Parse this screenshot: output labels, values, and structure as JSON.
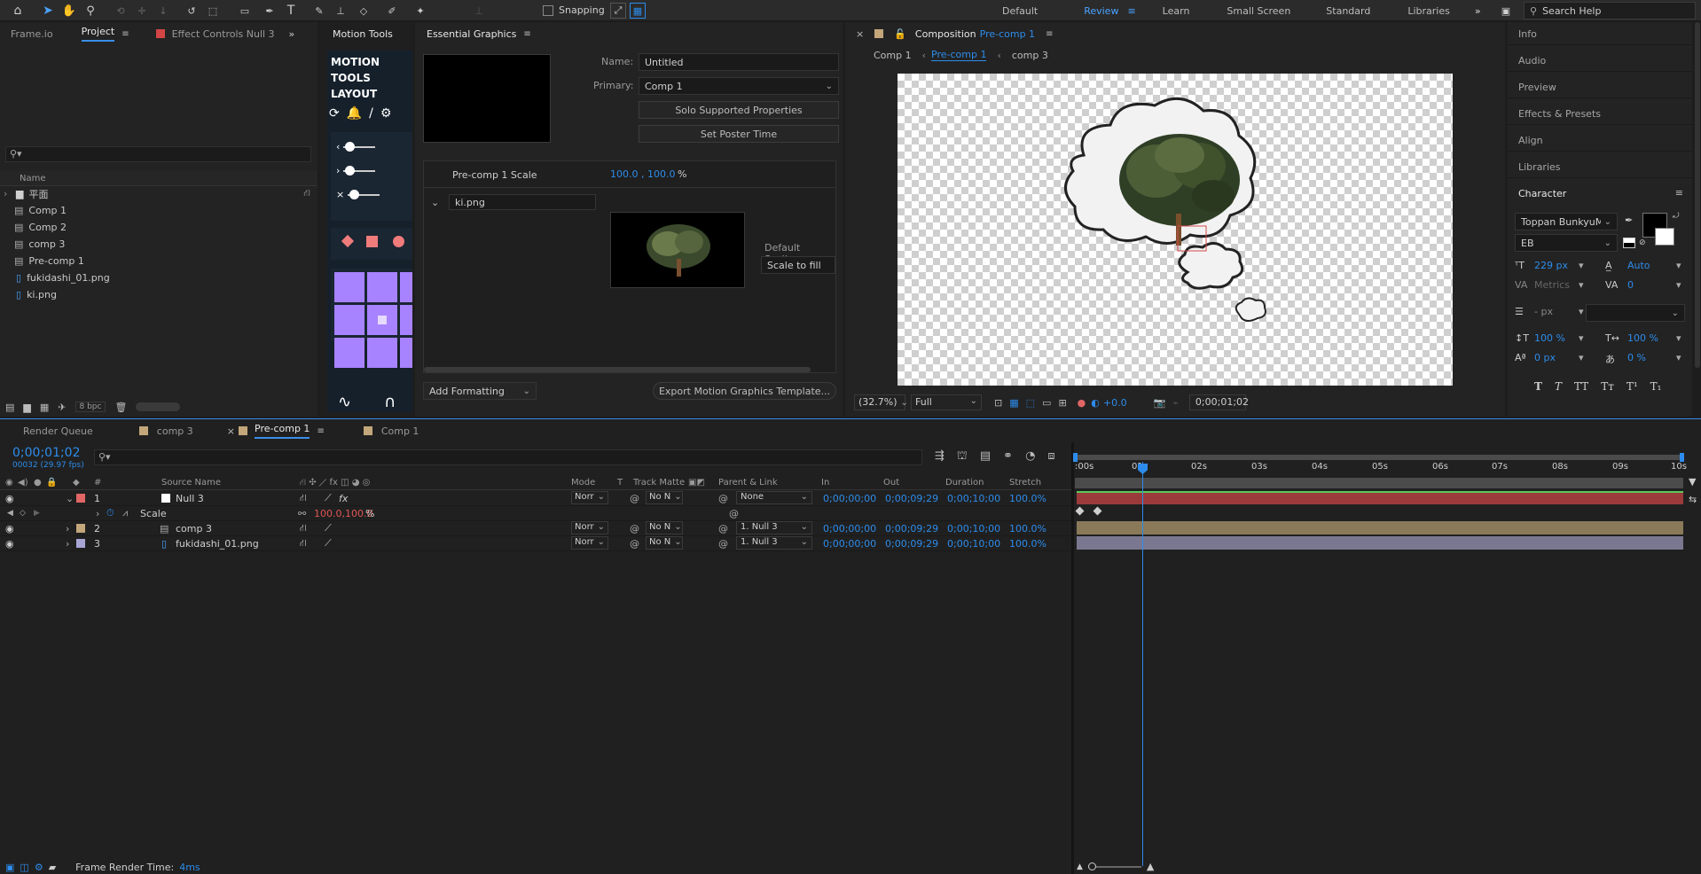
{
  "toolbar": {
    "snapping_label": "Snapping",
    "workspaces": [
      "Default",
      "Review",
      "Learn",
      "Small Screen",
      "Standard",
      "Libraries"
    ],
    "active_workspace": "Review",
    "search_placeholder": "Search Help"
  },
  "project_panel": {
    "tabs": [
      "Frame.io",
      "Project",
      "Effect Controls Null 3"
    ],
    "column_name": "Name",
    "items": [
      {
        "name": "平面",
        "type": "folder"
      },
      {
        "name": "Comp 1",
        "type": "comp"
      },
      {
        "name": "Comp 2",
        "type": "comp"
      },
      {
        "name": "comp 3",
        "type": "comp"
      },
      {
        "name": "Pre-comp 1",
        "type": "comp"
      },
      {
        "name": "fukidashi_01.png",
        "type": "file"
      },
      {
        "name": "ki.png",
        "type": "file"
      }
    ],
    "bpc": "8 bpc"
  },
  "motion_tools": {
    "tab": "Motion Tools",
    "title_lines": [
      "MOTION",
      "TOOLS",
      "LAYOUT"
    ]
  },
  "essential_graphics": {
    "tab": "Essential Graphics",
    "name_label": "Name:",
    "name_value": "Untitled",
    "primary_label": "Primary:",
    "primary_value": "Comp 1",
    "solo_button": "Solo Supported Properties",
    "poster_button": "Set Poster Time",
    "scale_label": "Pre-comp 1 Scale",
    "scale_value": "100.0 , 100.0",
    "scale_unit": "%",
    "media_name": "ki.png",
    "default_scaling_label": "Default Scaling:",
    "default_scaling_value": "Scale to fill",
    "add_formatting": "Add Formatting",
    "export_button": "Export Motion Graphics Template..."
  },
  "composition": {
    "tab_prefix": "Composition",
    "tab_name": "Pre-comp 1",
    "breadcrumbs": [
      "Comp 1",
      "Pre-comp 1",
      "comp 3"
    ],
    "zoom": "(32.7%)",
    "resolution": "Full",
    "exposure": "+0.0",
    "timecode": "0;00;01;02"
  },
  "right_panel": {
    "items": [
      "Info",
      "Audio",
      "Preview",
      "Effects & Presets",
      "Align",
      "Libraries",
      "Character"
    ],
    "font_name": "Toppan BunkyuM...",
    "font_style": "EB",
    "font_size": "229 px",
    "leading": "Auto",
    "kerning": "Metrics",
    "tracking": "0",
    "stroke_width": "- px",
    "vscale": "100 %",
    "hscale": "100 %",
    "baseline": "0 px",
    "tsume": "0 %",
    "style_buttons": [
      "T",
      "T",
      "TT",
      "Tт",
      "T¹",
      "T₁"
    ]
  },
  "timeline": {
    "tabs": [
      "Render Queue",
      "comp 3",
      "Pre-comp 1",
      "Comp 1"
    ],
    "active_tab": "Pre-comp 1",
    "current_time": "0;00;01;02",
    "frame_info": "00032 (29.97 fps)",
    "columns": {
      "num": "#",
      "source": "Source Name",
      "mode": "Mode",
      "t": "T",
      "track_matte": "Track Matte",
      "parent": "Parent & Link",
      "in": "In",
      "out": "Out",
      "duration": "Duration",
      "stretch": "Stretch"
    },
    "layers": [
      {
        "num": "1",
        "name": "Null 3",
        "color": "#e06666",
        "mode": "Norr",
        "matte": "No N",
        "parent": "None",
        "in": "0;00;00;00",
        "out": "0;00;09;29",
        "duration": "0;00;10;00",
        "stretch": "100.0%"
      },
      {
        "num": "2",
        "name": "comp 3",
        "color": "#c3a77b",
        "mode": "Norr",
        "matte": "No N",
        "parent": "1. Null 3",
        "in": "0;00;00;00",
        "out": "0;00;09;29",
        "duration": "0;00;10;00",
        "stretch": "100.0%"
      },
      {
        "num": "3",
        "name": "fukidashi_01.png",
        "color": "#a9a6d6",
        "mode": "Norr",
        "matte": "No N",
        "parent": "1. Null 3",
        "in": "0;00;00;00",
        "out": "0;00;09;29",
        "duration": "0;00;10;00",
        "stretch": "100.0%"
      }
    ],
    "scale_property": "Scale",
    "scale_value": "100.0,100.0",
    "scale_unit": "%",
    "ruler": [
      ":00s",
      "01s",
      "02s",
      "03s",
      "04s",
      "05s",
      "06s",
      "07s",
      "08s",
      "09s",
      "10s"
    ],
    "status_label": "Frame Render Time:",
    "status_value": "4ms"
  },
  "colors": {
    "accent": "#2d8ceb",
    "null_bar": "#9b3a3a",
    "comp_bar": "#8a7a5a",
    "png_bar": "#7a7890",
    "motion_purple": "#a883ff"
  }
}
